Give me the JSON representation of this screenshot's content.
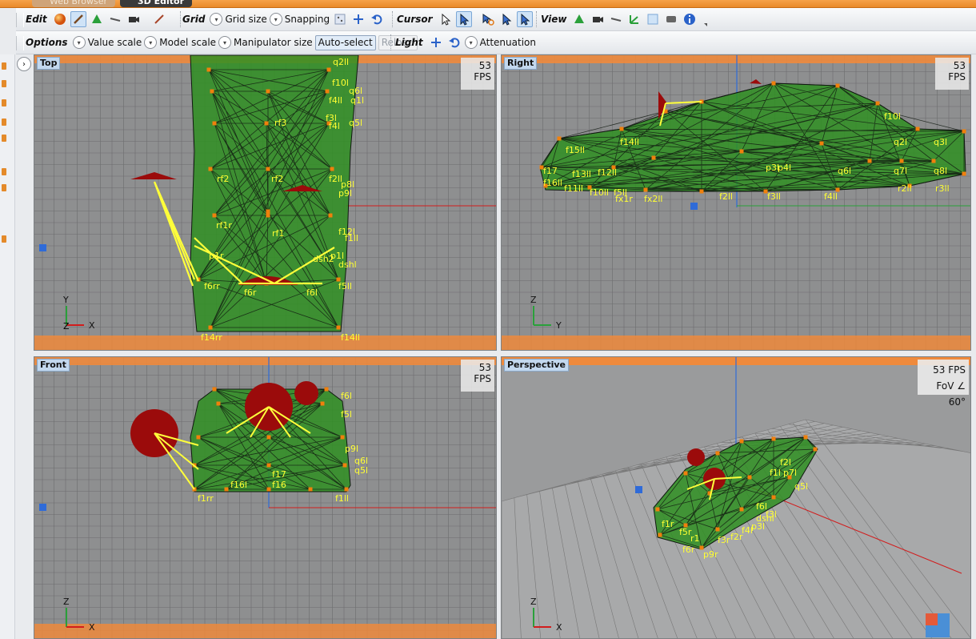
{
  "tabs": [
    {
      "label": "Web Browser"
    },
    {
      "label": "3D Editor"
    }
  ],
  "toolbar1": {
    "edit_label": "Edit",
    "grid_label": "Grid",
    "grid_size_label": "Grid size",
    "snapping_label": "Snapping",
    "cursor_label": "Cursor",
    "view_label": "View"
  },
  "toolbar2": {
    "options_label": "Options",
    "value_scale_label": "Value scale",
    "model_scale_label": "Model scale",
    "manipulator_size_label": "Manipulator size",
    "auto_select_label": "Auto-select",
    "reload_label": "Reload",
    "light_label": "Light",
    "attenuation_label": "Attenuation"
  },
  "viewports": {
    "top": {
      "label": "Top",
      "fps": "53 FPS",
      "axis_x": "X",
      "axis_y": "Y",
      "axis_z": "Z",
      "labels": [
        "q2ll",
        "f10l",
        "f4ll",
        "q6l",
        "q1l",
        "f4l",
        "f3l",
        "q5l",
        "rf3",
        "rf2",
        "rf2",
        "f2ll",
        "p8l",
        "p9l",
        "rf1r",
        "rf1",
        "f12l",
        "f1ll",
        "p1r",
        "p1l",
        "f6rr",
        "f6r",
        "f6l",
        "f5ll",
        "f14rr",
        "f14ll",
        "dsh2",
        "dshl"
      ]
    },
    "right": {
      "label": "Right",
      "fps": "53 FPS",
      "axis_z": "Z",
      "axis_y": "Y",
      "labels": [
        "f10l",
        "f15ll",
        "f14ll",
        "f13ll",
        "f17",
        "f16ll",
        "f11ll",
        "f12ll",
        "f10ll",
        "f5ll",
        "fx1r",
        "fx2ll",
        "p3l",
        "p4l",
        "q6l",
        "q7l",
        "q8l",
        "q2l",
        "q3l",
        "f2ll",
        "f3ll",
        "f4ll",
        "r2ll",
        "r3ll"
      ]
    },
    "front": {
      "label": "Front",
      "fps": "53 FPS",
      "axis_z": "Z",
      "axis_x": "X",
      "labels": [
        "f6l",
        "f5l",
        "f17",
        "f16",
        "f1rr",
        "f1ll",
        "q6l",
        "q5l",
        "p9l",
        "f16l"
      ]
    },
    "perspective": {
      "label": "Perspective",
      "fps": "53 FPS",
      "fov": "FoV ∠ 60°",
      "labels": [
        "f2l",
        "f1l",
        "p7l",
        "q5l",
        "f6l",
        "dshl",
        "f3l",
        "p3l",
        "f4l"
      ]
    }
  },
  "colors": {
    "model_fill": "#2f8f22",
    "wire": "#101810",
    "vertex": "#f0800c",
    "label": "#ffff33",
    "light_red": "#9b0b0b",
    "light_line": "#ffff3a",
    "grid_bg": "#8e8f90",
    "grid_line": "#6c6d6e",
    "orange_edge": "#ef8a3c"
  },
  "icons": [
    "sphere-icon",
    "brush-icon",
    "cone-icon",
    "line-icon",
    "camera-icon",
    "paint-icon",
    "grid-dots-icon",
    "move-icon",
    "undo-icon",
    "cursor-icon",
    "select-arrow-icon",
    "rotate-cursor-icon",
    "view-cone-icon",
    "view-info-icon",
    "light-move-icon",
    "light-undo-icon"
  ]
}
